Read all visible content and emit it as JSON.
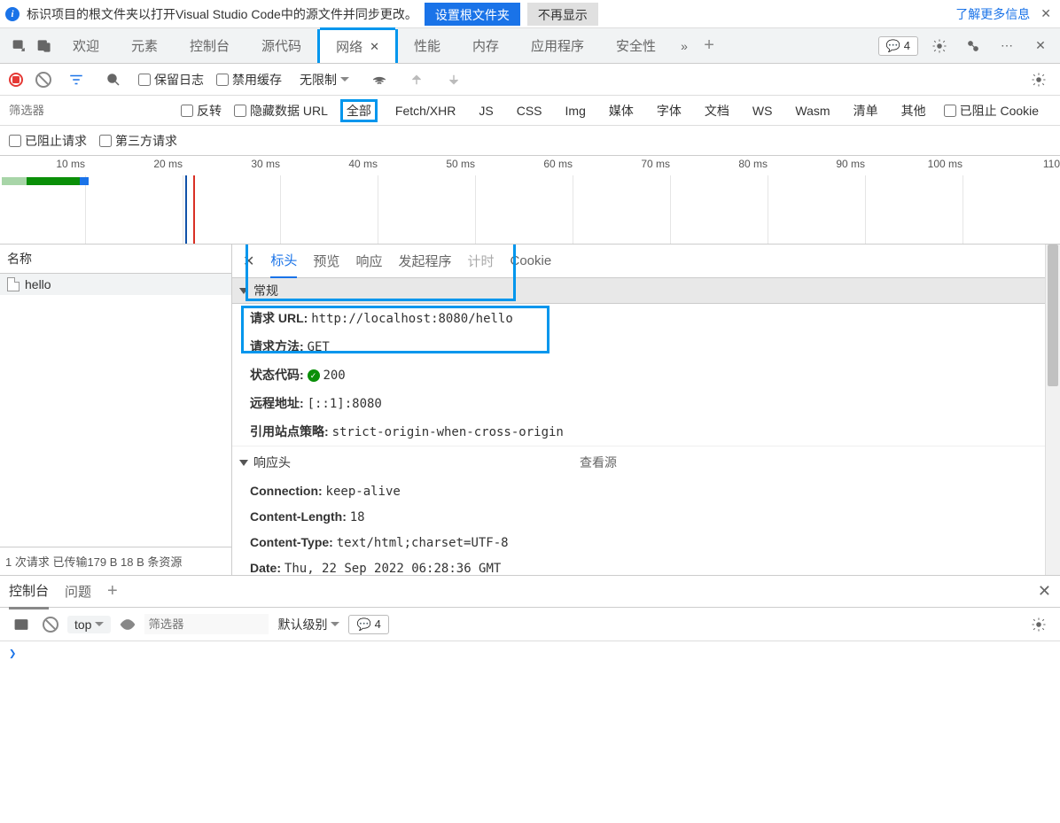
{
  "info_bar": {
    "message": "标识项目的根文件夹以打开Visual Studio Code中的源文件并同步更改。",
    "btn_set": "设置根文件夹",
    "btn_dismiss": "不再显示",
    "link_more": "了解更多信息"
  },
  "main_tabs": {
    "items": [
      "欢迎",
      "元素",
      "控制台",
      "源代码",
      "网络",
      "性能",
      "内存",
      "应用程序",
      "安全性"
    ],
    "active": "网络",
    "issues_count": "4"
  },
  "toolbar": {
    "preserve_log": "保留日志",
    "disable_cache": "禁用缓存",
    "throttling": "无限制"
  },
  "filters": {
    "placeholder": "筛选器",
    "invert": "反转",
    "hide_data": "隐藏数据 URL",
    "types": [
      "全部",
      "Fetch/XHR",
      "JS",
      "CSS",
      "Img",
      "媒体",
      "字体",
      "文档",
      "WS",
      "Wasm",
      "清单",
      "其他"
    ],
    "blocked_cookies": "已阻止 Cookie",
    "blocked_req": "已阻止请求",
    "third_party": "第三方请求"
  },
  "timeline": {
    "ticks": [
      "10 ms",
      "20 ms",
      "30 ms",
      "40 ms",
      "50 ms",
      "60 ms",
      "70 ms",
      "80 ms",
      "90 ms",
      "100 ms",
      "110"
    ]
  },
  "name_col": "名称",
  "requests": [
    {
      "name": "hello"
    }
  ],
  "status_text": "1 次请求  已传输179 B  18 B 条资源",
  "detail_tabs": {
    "headers": "标头",
    "preview": "预览",
    "response": "响应",
    "initiator": "发起程序",
    "timing": "计时",
    "cookie": "Cookie"
  },
  "general": {
    "title": "常规",
    "url_k": "请求 URL:",
    "url_v": "http://localhost:8080/hello",
    "method_k": "请求方法:",
    "method_v": "GET",
    "status_k": "状态代码:",
    "status_v": "200",
    "remote_k": "远程地址:",
    "remote_v": "[::1]:8080",
    "policy_k": "引用站点策略:",
    "policy_v": "strict-origin-when-cross-origin"
  },
  "resp_headers": {
    "title": "响应头",
    "view_source": "查看源",
    "items": [
      {
        "k": "Connection:",
        "v": "keep-alive"
      },
      {
        "k": "Content-Length:",
        "v": "18"
      },
      {
        "k": "Content-Type:",
        "v": "text/html;charset=UTF-8"
      },
      {
        "k": "Date:",
        "v": "Thu, 22 Sep 2022 06:28:36 GMT"
      }
    ]
  },
  "console": {
    "tab_console": "控制台",
    "tab_issues": "问题",
    "ctx": "top",
    "filter_ph": "筛选器",
    "level": "默认级别",
    "issues_count": "4",
    "prompt": "❯"
  }
}
